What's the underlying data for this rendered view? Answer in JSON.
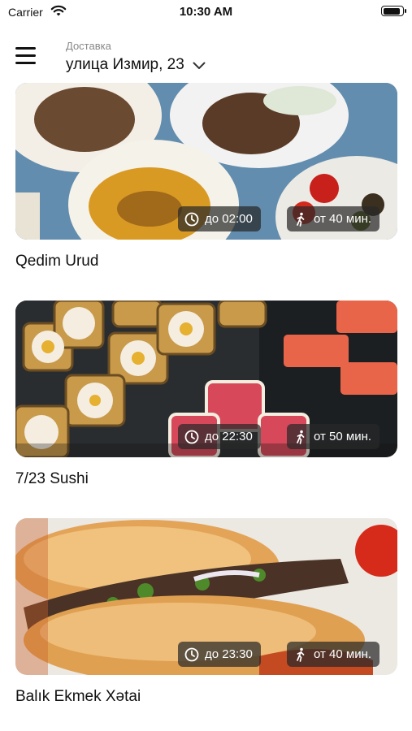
{
  "status_bar": {
    "carrier": "Carrier",
    "time": "10:30 AM"
  },
  "header": {
    "delivery_label": "Доставка",
    "address": "улица Измир, 23"
  },
  "restaurants": [
    {
      "name": "Qedim Urud",
      "hours": "до 02:00",
      "eta": "от 40 мин."
    },
    {
      "name": "7/23 Sushi",
      "hours": "до 22:30",
      "eta": "от 50 мин."
    },
    {
      "name": "Balık Ekmek Xətai",
      "hours": "до 23:30",
      "eta": "от 40 мин."
    }
  ],
  "colors": {
    "text": "#111111",
    "muted": "#888888",
    "badge_bg": "rgba(40,40,40,0.72)"
  },
  "icons": [
    "menu-icon",
    "chevron-down-icon",
    "clock-icon",
    "walking-person-icon",
    "wifi-icon",
    "battery-icon"
  ]
}
